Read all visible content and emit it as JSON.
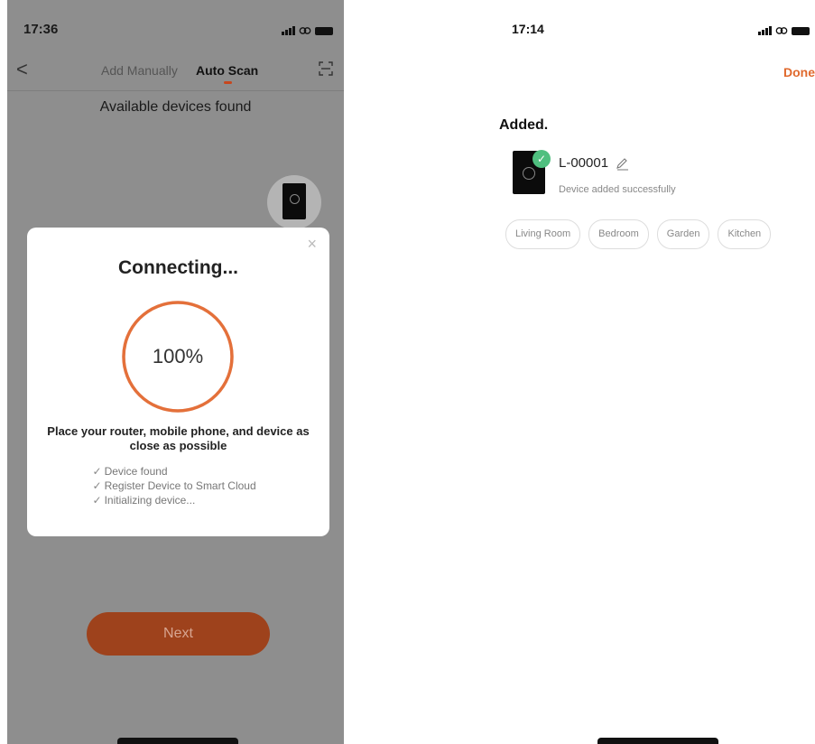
{
  "left_screen": {
    "status": {
      "time": "17:36"
    },
    "nav": {
      "back": "<",
      "tab_manual": "Add Manually",
      "tab_auto": "Auto Scan"
    },
    "subtitle": "Available devices found",
    "dialog": {
      "close": "×",
      "title": "Connecting...",
      "progress_value": 100,
      "progress_text": "100%",
      "note": "Place your router, mobile phone, and device as close as possible",
      "steps": [
        "Device found",
        "Register Device to Smart Cloud",
        "Initializing device..."
      ]
    },
    "next_label": "Next"
  },
  "right_screen": {
    "status": {
      "time": "17:14"
    },
    "done_label": "Done",
    "added_title": "Added.",
    "device": {
      "name": "L-00001",
      "status": "Device added successfully"
    },
    "rooms": [
      "Living Room",
      "Bedroom",
      "Garden",
      "Kitchen"
    ]
  },
  "colors": {
    "accent": "#e0692d",
    "progress": "#e4703a",
    "success": "#4fbf7f",
    "next_button": "#9e421c"
  },
  "icons": {
    "back": "chevron-left-icon",
    "scan": "scan-frame-icon",
    "close": "close-icon",
    "check": "checkmark-icon",
    "edit": "pencil-icon"
  }
}
